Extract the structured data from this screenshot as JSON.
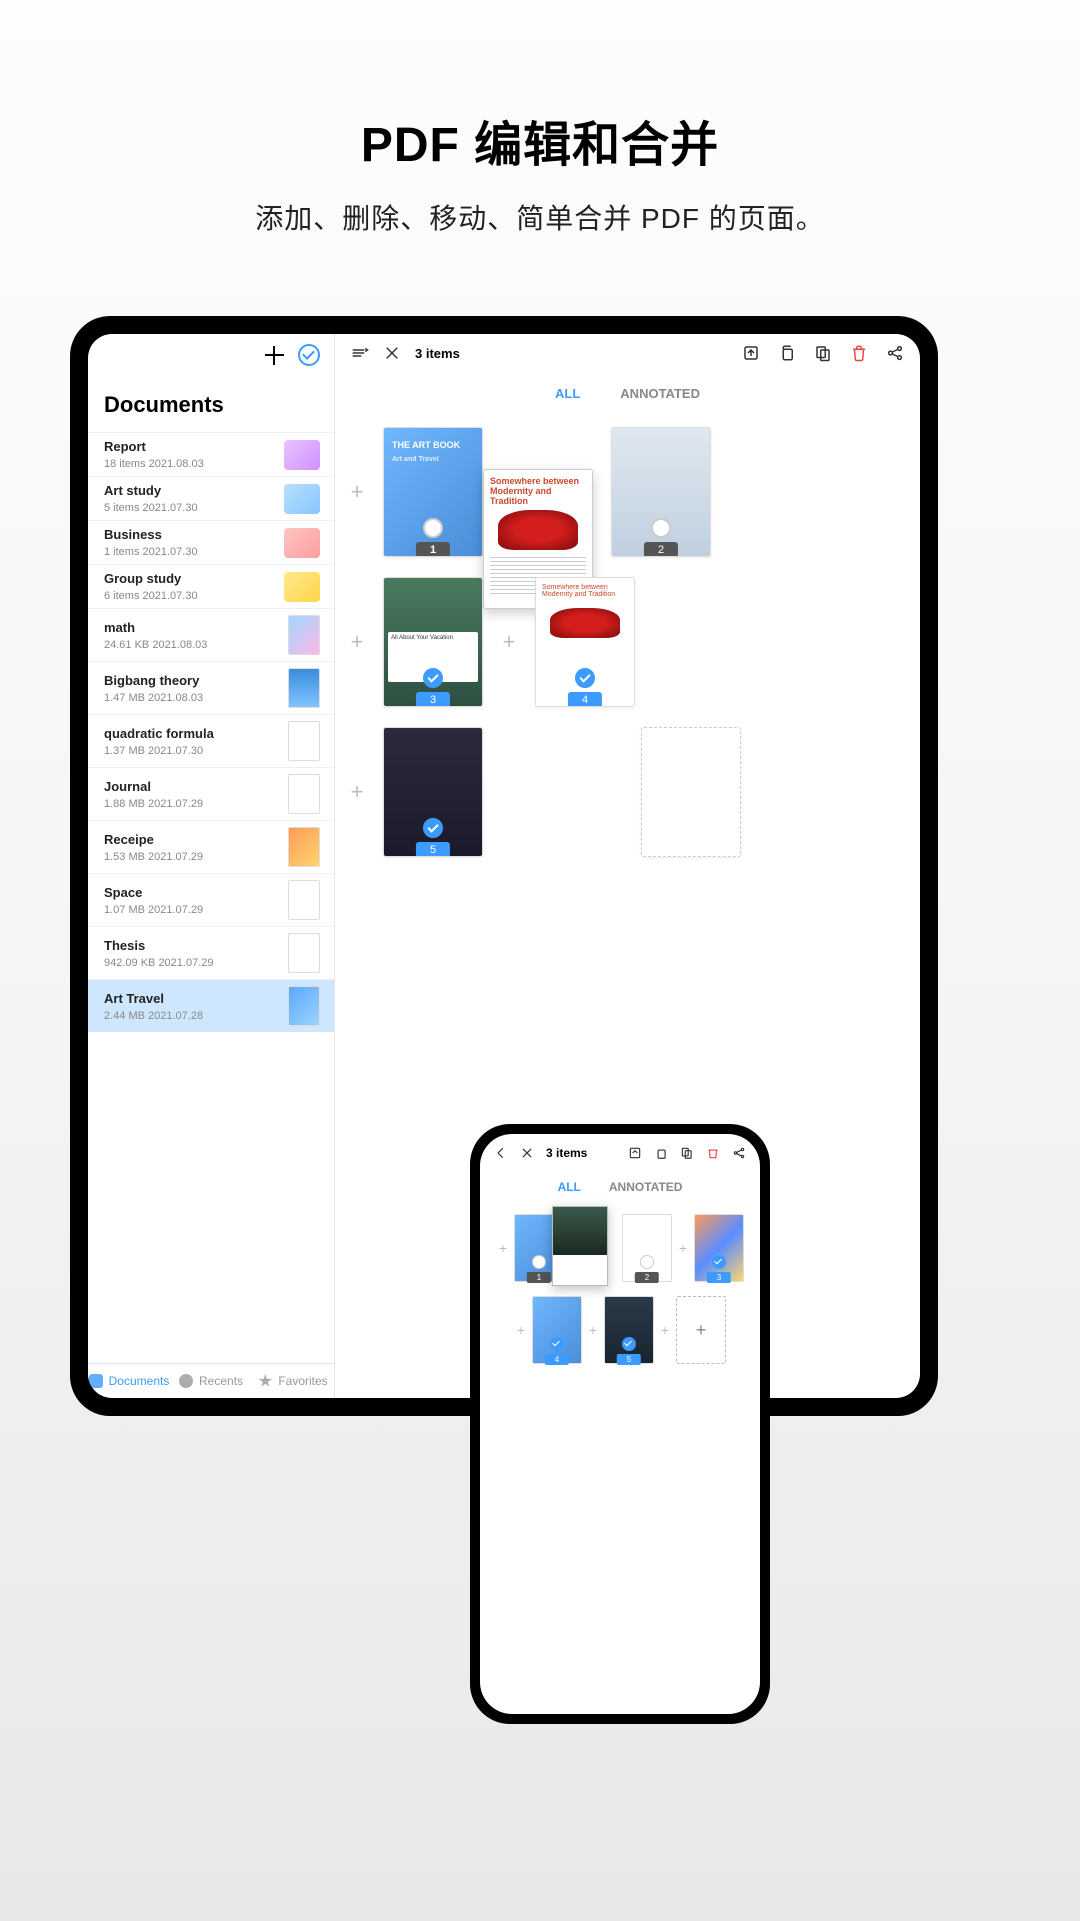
{
  "hero": {
    "title": "PDF 编辑和合并",
    "subtitle": "添加、删除、移动、简单合并 PDF 的页面。"
  },
  "sidebar": {
    "heading": "Documents",
    "items": [
      {
        "name": "Report",
        "meta1": "18 items",
        "meta2": "2021.08.03",
        "thumb": "folder-purple"
      },
      {
        "name": "Art study",
        "meta1": "5 items",
        "meta2": "2021.07.30",
        "thumb": "folder-blue"
      },
      {
        "name": "Business",
        "meta1": "1 items",
        "meta2": "2021.07.30",
        "thumb": "folder-pink"
      },
      {
        "name": "Group study",
        "meta1": "6 items",
        "meta2": "2021.07.30",
        "thumb": "folder-yellow"
      },
      {
        "name": "math",
        "meta1": "24.61 KB",
        "meta2": "2021.08.03",
        "thumb": "doc-grad"
      },
      {
        "name": "Bigbang theory",
        "meta1": "1.47 MB",
        "meta2": "2021.08.03",
        "thumb": "doc-sky"
      },
      {
        "name": "quadratic formula",
        "meta1": "1.37 MB",
        "meta2": "2021.07.30",
        "thumb": "doc"
      },
      {
        "name": "Journal",
        "meta1": "1.88 MB",
        "meta2": "2021.07.29",
        "thumb": "doc"
      },
      {
        "name": "Receipe",
        "meta1": "1.53 MB",
        "meta2": "2021.07.29",
        "thumb": "doc-art"
      },
      {
        "name": "Space",
        "meta1": "1.07 MB",
        "meta2": "2021.07.29",
        "thumb": "doc"
      },
      {
        "name": "Thesis",
        "meta1": "942.09 KB",
        "meta2": "2021.07.29",
        "thumb": "doc"
      },
      {
        "name": "Art Travel",
        "meta1": "2.44 MB",
        "meta2": "2021.07.28",
        "thumb": "doc-blue2",
        "selected": true
      }
    ],
    "tabs": {
      "documents": "Documents",
      "recents": "Recents",
      "favorites": "Favorites"
    }
  },
  "main": {
    "item_count": "3 items",
    "tabs": {
      "all": "ALL",
      "annotated": "ANNOTATED"
    },
    "drag_headline": "Somewhere between Modernity and Tradition",
    "art_title": "THE ART BOOK",
    "art_sub": "Art and Travel",
    "vacation_title": "All About Your Vacation",
    "pages": {
      "p1": "1",
      "p2": "2",
      "p3": "3",
      "p4": "4",
      "p5": "5"
    }
  },
  "phone": {
    "item_count": "3 items",
    "tabs": {
      "all": "ALL",
      "annotated": "ANNOTATED"
    },
    "pages": {
      "p1": "1",
      "p2": "2",
      "p3": "3",
      "p4": "4",
      "p5": "5"
    }
  }
}
